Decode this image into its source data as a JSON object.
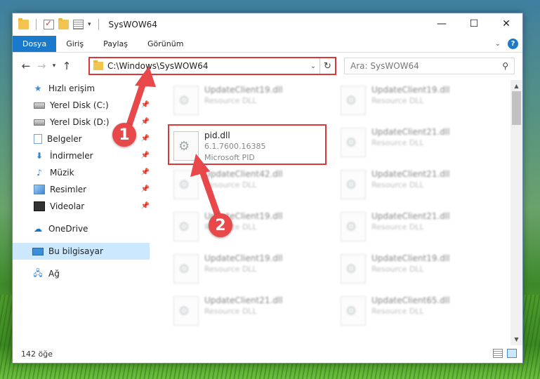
{
  "window": {
    "title": "SysWOW64",
    "caption": {
      "minimize": "—",
      "maximize": "☐",
      "close": "✕"
    }
  },
  "ribbon": {
    "tabs": [
      {
        "label": "Dosya",
        "active": true
      },
      {
        "label": "Giriş"
      },
      {
        "label": "Paylaş"
      },
      {
        "label": "Görünüm"
      }
    ],
    "help": "?"
  },
  "address": {
    "path": "C:\\Windows\\SysWOW64",
    "search_placeholder": "Ara: SysWOW64"
  },
  "nav": {
    "items": [
      {
        "label": "Hızlı erişim",
        "icon": "star-icon",
        "level": 1
      },
      {
        "label": "Yerel Disk (C:)",
        "icon": "drive-icon",
        "pinned": true,
        "level": 2
      },
      {
        "label": "Yerel Disk (D:)",
        "icon": "drive-icon",
        "pinned": true,
        "level": 2
      },
      {
        "label": "Belgeler",
        "icon": "documents-icon",
        "pinned": true,
        "level": 2
      },
      {
        "label": "İndirmeler",
        "icon": "downloads-icon",
        "pinned": true,
        "level": 2
      },
      {
        "label": "Müzik",
        "icon": "music-icon",
        "pinned": true,
        "level": 2
      },
      {
        "label": "Resimler",
        "icon": "pictures-icon",
        "pinned": true,
        "level": 2
      },
      {
        "label": "Videolar",
        "icon": "videos-icon",
        "pinned": true,
        "level": 2
      },
      {
        "label": "OneDrive",
        "icon": "onedrive-icon",
        "level": 1
      },
      {
        "label": "Bu bilgisayar",
        "icon": "this-pc-icon",
        "level": 1,
        "selected": true
      },
      {
        "label": "Ağ",
        "icon": "network-icon",
        "level": 1
      }
    ]
  },
  "files": {
    "highlighted": {
      "name": "pid.dll",
      "version": "6.1.7600.16385",
      "company": "Microsoft PID"
    },
    "blurred": [
      {
        "name": "UpdateClient19.dll",
        "type": "Resource DLL"
      },
      {
        "name": "UpdateClient19.dll",
        "type": "Resource DLL"
      },
      {
        "name": "UpdateClient21.dll",
        "type": "Resource DLL"
      },
      {
        "name": "UpdateClient42.dll",
        "type": "Resource DLL"
      },
      {
        "name": "UpdateClient21.dll",
        "type": "Resource DLL"
      },
      {
        "name": "UpdateClient19.dll",
        "type": "Resource DLL"
      },
      {
        "name": "UpdateClient21.dll",
        "type": "Resource DLL"
      },
      {
        "name": "UpdateClient19.dll",
        "type": "Resource DLL"
      },
      {
        "name": "UpdateClient19.dll",
        "type": "Resource DLL"
      },
      {
        "name": "UpdateClient21.dll",
        "type": "Resource DLL"
      },
      {
        "name": "UpdateClient65.dll",
        "type": "Resource DLL"
      }
    ]
  },
  "status": {
    "count": "142 öğe"
  },
  "annotations": {
    "step1": "1",
    "step2": "2"
  },
  "colors": {
    "accent": "#1979ca",
    "highlight_border": "#d9383b",
    "annotation": "#e8484a"
  }
}
